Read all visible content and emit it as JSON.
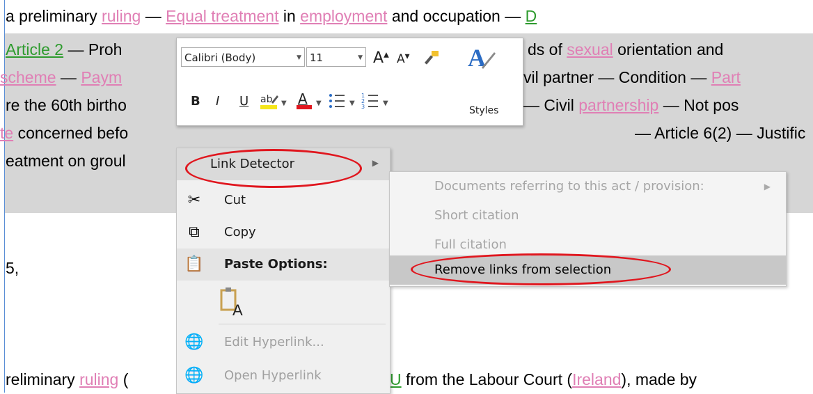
{
  "document": {
    "lines": [
      {
        "parts": [
          {
            "t": "a preliminary "
          },
          {
            "t": "ruling",
            "link": "pink"
          },
          {
            "t": " — "
          },
          {
            "t": "Equal treatment",
            "link": "pink"
          },
          {
            "t": " in "
          },
          {
            "t": "employment",
            "link": "pink"
          },
          {
            "t": " and occupation — "
          },
          {
            "t": "D",
            "link": "green"
          }
        ]
      },
      {
        "parts": [
          {
            "t": "Article 2",
            "link": "green"
          },
          {
            "t": " — Proh"
          }
        ]
      },
      {
        "parts": [
          {
            "t": "ds of "
          },
          {
            "t": "sexual",
            "link": "pink"
          },
          {
            "t": " orientation and"
          }
        ]
      },
      {
        "parts": [
          {
            "t": "scheme",
            "link": "pink"
          },
          {
            "t": " — "
          },
          {
            "t": "Paym",
            "link": "pink"
          }
        ]
      },
      {
        "parts": [
          {
            "t": "vil partner — Condition — "
          },
          {
            "t": "Part",
            "link": "pink"
          }
        ]
      },
      {
        "parts": [
          {
            "t": "re the 60th birtho"
          }
        ]
      },
      {
        "parts": [
          {
            "t": "— Civil "
          },
          {
            "t": "partnership",
            "link": "pink"
          },
          {
            "t": " — Not pos"
          }
        ]
      },
      {
        "parts": [
          {
            "t": "te",
            "link": "pink"
          },
          {
            "t": " concerned befo"
          }
        ]
      },
      {
        "parts": [
          {
            "t": "— Article 6(2) — Justific"
          }
        ]
      },
      {
        "parts": [
          {
            "t": "eatment on groul"
          }
        ]
      },
      {
        "parts": [
          {
            "t": "5,"
          }
        ]
      },
      {
        "parts": [
          {
            "t": "reliminary "
          },
          {
            "t": "ruling",
            "link": "pink"
          },
          {
            "t": " ("
          }
        ]
      },
      {
        "parts": [
          {
            "t": "U",
            "link": "green"
          },
          {
            "t": " from the Labour Court ("
          },
          {
            "t": "Ireland",
            "link": "pink"
          },
          {
            "t": "), made by "
          }
        ]
      }
    ]
  },
  "mini_toolbar": {
    "font_name": "Calibri (Body)",
    "font_size": "11",
    "grow_font": "A",
    "shrink_font": "A",
    "bold": "B",
    "italic": "I",
    "underline": "U",
    "font_color": "A",
    "styles_label": "Styles",
    "icons": {
      "format_painter": "format-painter-icon",
      "styles": "styles-icon",
      "highlight": "highlighter-icon",
      "bullets": "bullets-icon",
      "numbering": "numbering-icon"
    }
  },
  "context_menu": {
    "items": [
      {
        "label": "Link Detector",
        "icon": "",
        "submenu": true,
        "highlighted": true
      },
      {
        "label": "Cut",
        "icon": "scissors-icon"
      },
      {
        "label": "Copy",
        "icon": "copy-icon"
      },
      {
        "label": "Paste Options:",
        "icon": "paste-icon",
        "bold": true
      },
      {
        "label": "",
        "icon": "paste-keep-text-icon"
      },
      {
        "label": "Edit Hyperlink...",
        "icon": "edit-hyperlink-icon",
        "disabled": true
      },
      {
        "label": "Open Hyperlink",
        "icon": "open-hyperlink-icon",
        "disabled": true
      }
    ]
  },
  "submenu": {
    "items": [
      {
        "label": "Documents referring to this act / provision:",
        "disabled": true,
        "submenu": true
      },
      {
        "label": "Short citation",
        "disabled": true
      },
      {
        "label": "Full citation",
        "disabled": true
      },
      {
        "label": "Remove links from selection",
        "highlighted": true
      }
    ]
  },
  "colors": {
    "link_pink": "#e07fb5",
    "link_green": "#2e9b2e",
    "annotation_red": "#e0161e",
    "selection": "#d6d6d6"
  }
}
